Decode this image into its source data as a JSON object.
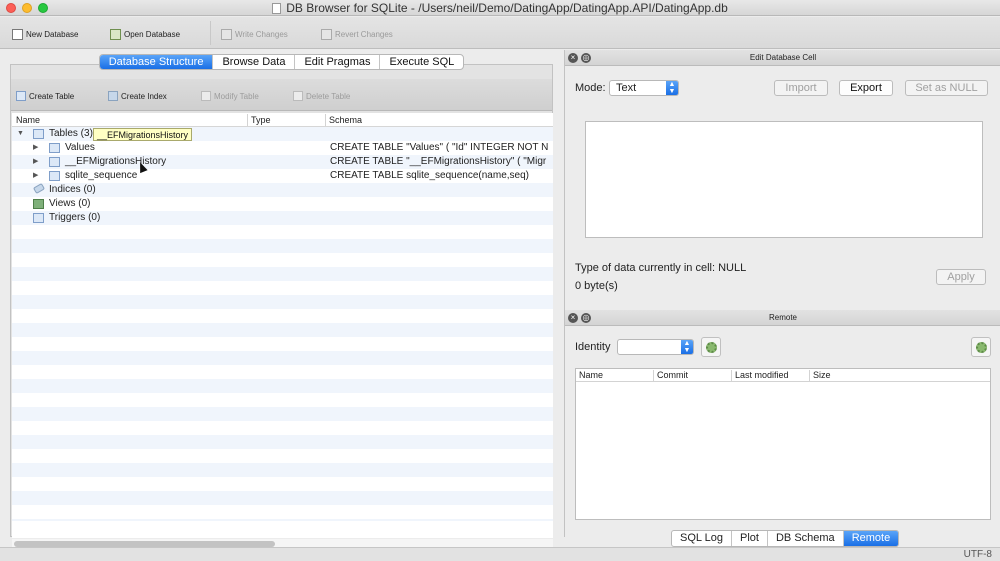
{
  "window": {
    "title": "DB Browser for SQLite - /Users/neil/Demo/DatingApp/DatingApp.API/DatingApp.db"
  },
  "toolbar": {
    "new_database": "New Database",
    "open_database": "Open Database",
    "write_changes": "Write Changes",
    "revert_changes": "Revert Changes"
  },
  "main_tabs": [
    {
      "label": "Database Structure",
      "active": true
    },
    {
      "label": "Browse Data",
      "active": false
    },
    {
      "label": "Edit Pragmas",
      "active": false
    },
    {
      "label": "Execute SQL",
      "active": false
    }
  ],
  "structure_toolbar": {
    "create_table": "Create Table",
    "create_index": "Create Index",
    "modify_table": "Modify Table",
    "delete_table": "Delete Table"
  },
  "tree": {
    "columns": [
      "Name",
      "Type",
      "Schema"
    ],
    "tables_label": "Tables (3)",
    "tables": [
      {
        "name": "Values",
        "schema": "CREATE TABLE \"Values\" ( \"Id\" INTEGER NOT N"
      },
      {
        "name": "__EFMigrationsHistory",
        "schema": "CREATE TABLE \"__EFMigrationsHistory\" ( \"Migr"
      },
      {
        "name": "sqlite_sequence",
        "schema": "CREATE TABLE sqlite_sequence(name,seq)"
      }
    ],
    "indices_label": "Indices (0)",
    "views_label": "Views (0)",
    "triggers_label": "Triggers (0)",
    "tooltip": "__EFMigrationsHistory"
  },
  "edit_cell": {
    "title": "Edit Database Cell",
    "mode_label": "Mode:",
    "mode_value": "Text",
    "import": "Import",
    "export": "Export",
    "set_null": "Set as NULL",
    "type_info": "Type of data currently in cell: NULL",
    "size_info": "0 byte(s)",
    "apply": "Apply"
  },
  "remote": {
    "title": "Remote",
    "identity_label": "Identity",
    "columns": [
      "Name",
      "Commit",
      "Last modified",
      "Size"
    ]
  },
  "bottom_tabs": [
    {
      "label": "SQL Log",
      "active": false
    },
    {
      "label": "Plot",
      "active": false
    },
    {
      "label": "DB Schema",
      "active": false
    },
    {
      "label": "Remote",
      "active": true
    }
  ],
  "status": {
    "encoding": "UTF-8"
  }
}
